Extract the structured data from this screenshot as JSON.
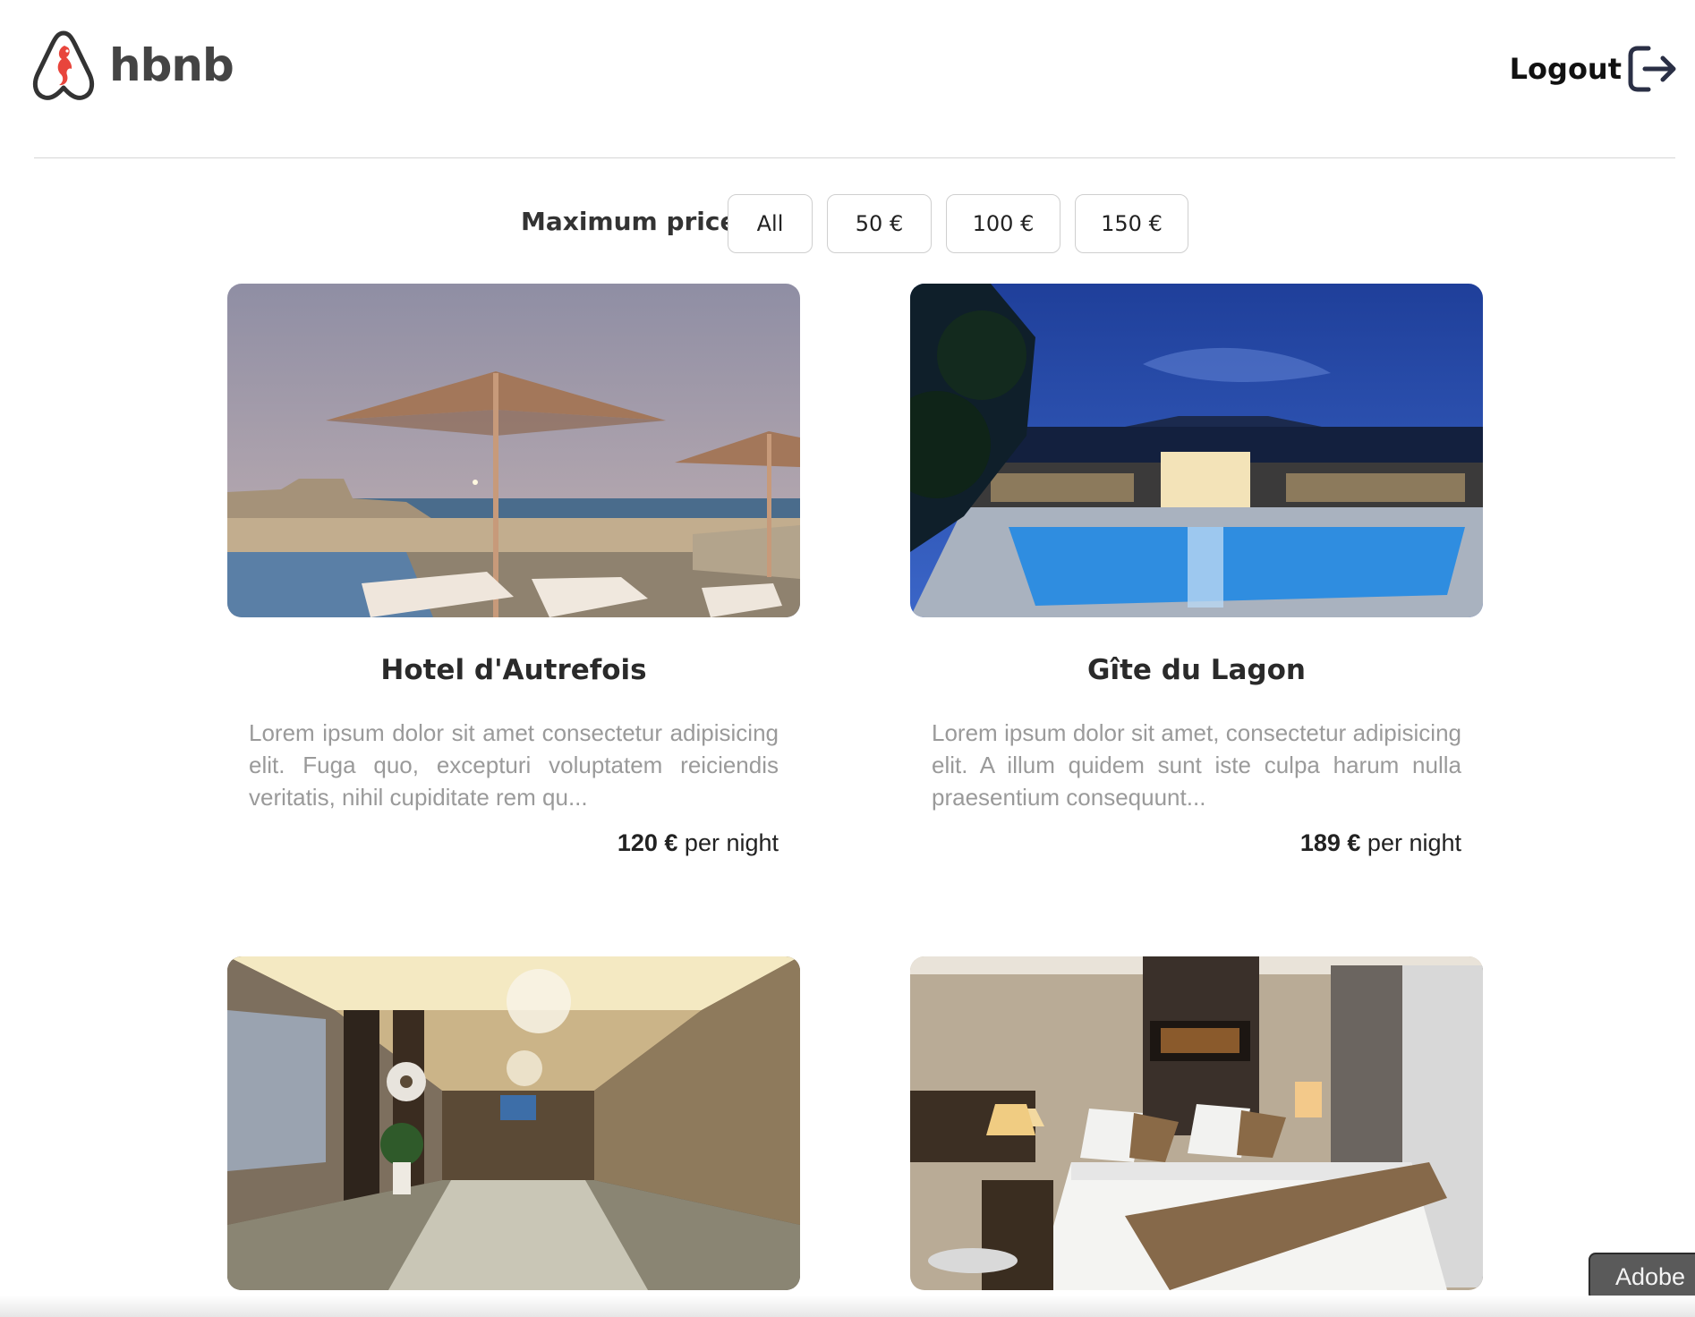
{
  "header": {
    "logo_text": "hbnb",
    "logout_label": "Logout",
    "brand_color": "#e8453c"
  },
  "filter": {
    "label": "Maximum price:",
    "options": [
      "All",
      "50 €",
      "100 €",
      "150 €"
    ]
  },
  "places": [
    {
      "title": "Hotel d'Autrefois",
      "description": "Lorem ipsum dolor sit amet consectetur adipisicing elit. Fuga quo, excepturi voluptatem reiciendis veritatis, nihil cupiditate rem qu...",
      "price": "120 €",
      "per_night": "per night"
    },
    {
      "title": "Gîte du Lagon",
      "description": "Lorem ipsum dolor sit amet, consectetur adipisicing elit. A illum quidem sunt iste culpa harum nulla praesentium consequunt...",
      "price": "189 €",
      "per_night": "per night"
    },
    {},
    {}
  ],
  "adobe_label": "Adobe"
}
